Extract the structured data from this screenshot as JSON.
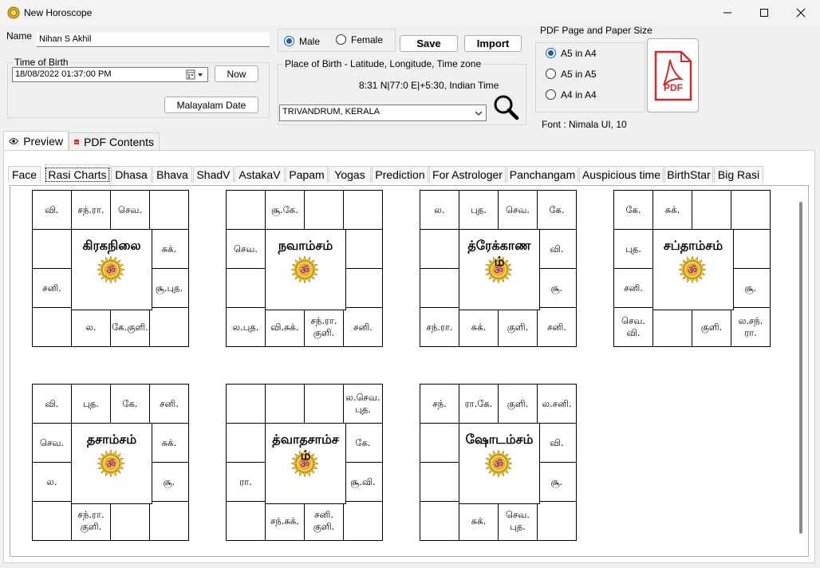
{
  "window": {
    "title": "New Horoscope"
  },
  "form": {
    "name_label": "Name",
    "name_value": "Nihan S Akhil",
    "gender_male": "Male",
    "gender_female": "Female",
    "save_label": "Save",
    "import_label": "Import",
    "time_of_birth_legend": "Time of Birth",
    "datetime_value": "18/08/2022  01:37:00 PM",
    "now_label": "Now",
    "malayalam_date_label": "Malayalam Date",
    "place_legend": "Place of Birth - Latitude, Longitude, Time zone",
    "coords_text": "8:31 N|77:0 E|+5:30, Indian Time",
    "place_value": "TRIVANDRUM, KERALA",
    "pdf_legend": "PDF Page and Paper Size",
    "paper_options": [
      "A5 in A4",
      "A5 in A5",
      "A4 in A4"
    ],
    "paper_selected": "A5 in A4",
    "pdf_icon_text": "PDF",
    "font_text": "Font : Nimala UI, 10"
  },
  "top_tabs": [
    "Preview",
    "PDF Contents"
  ],
  "inner_tabs": [
    "Face",
    "Rasi Charts",
    "Dhasa",
    "Bhava",
    "ShadV",
    "AstakaV",
    "Papam",
    "Yogas",
    "Prediction",
    "For Astrologer",
    "Panchangam",
    "Auspicious time",
    "BirthStar",
    "Big Rasi"
  ],
  "active_inner_tab": "Rasi Charts",
  "charts": [
    {
      "name": "கிரகநிலை",
      "cells": [
        "வி.",
        "சந்.ரா.",
        "செவ.",
        "",
        "சுக்.",
        "சூ.புத.",
        "",
        "கே.குளி.",
        "ல.",
        "",
        "சனி.",
        ""
      ]
    },
    {
      "name": "நவாம்சம்",
      "cells": [
        "",
        "சூ.கே.",
        "",
        "",
        "",
        "",
        "சனி.",
        "சந்.ரா.குளி.",
        "வி.சுக்.",
        "ல.புத.",
        "",
        "செவ."
      ]
    },
    {
      "name": "த்ரேக்காணம்",
      "cells": [
        "ல.",
        "புத.",
        "செவ.",
        "கே.",
        "வி.",
        "சூ.",
        "சனி.",
        "குளி.",
        "சுக்.",
        "சந்.ரா.",
        "",
        ""
      ]
    },
    {
      "name": "சப்தாம்சம்",
      "cells": [
        "கே.",
        "சுக்.",
        "",
        "",
        "",
        "சூ.",
        "ல.சந்.ரா.",
        "குளி.",
        "",
        "செவ.வி.",
        "சனி.",
        "புத."
      ]
    },
    {
      "name": "தசாம்சம்",
      "cells": [
        "வி.",
        "புத.",
        "கே.",
        "சனி.",
        "சுக்.",
        "சூ.",
        "",
        "",
        "சந்.ரா.குளி.",
        "",
        "ல.",
        "செவ."
      ]
    },
    {
      "name": "த்வாதசாம்சம்",
      "cells": [
        "",
        "",
        "",
        "ல.செவ.புத.",
        "கே.",
        "சூ.வி.",
        "",
        "சனி.குளி.",
        "சந்.சுக்.",
        "",
        "ரா.",
        ""
      ]
    },
    {
      "name": "ஷோடம்சம்",
      "cells": [
        "சந்.",
        "ரா.கே.",
        "குளி.",
        "ல.சனி.",
        "வி.",
        "சூ.",
        "",
        "செவ.புத.",
        "சுக்.",
        "",
        "",
        ""
      ]
    }
  ],
  "colors": {
    "accent": "#1a5fb4",
    "pdf_red": "#d22a2a"
  }
}
